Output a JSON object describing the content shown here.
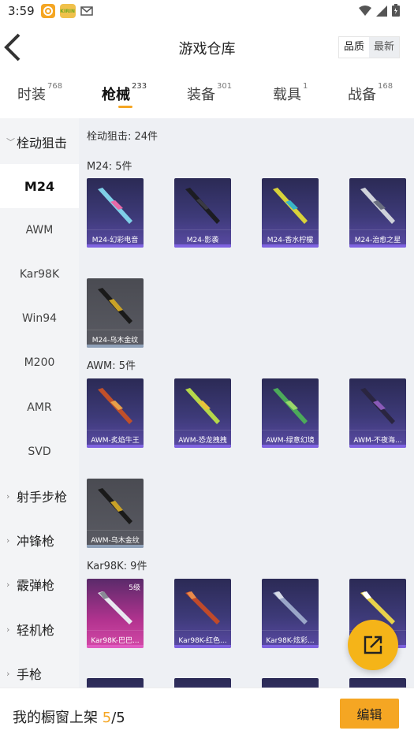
{
  "status": {
    "time": "3:59",
    "app2_label": "KIRIN"
  },
  "header": {
    "title": "游戏仓库",
    "sort_options": [
      "品质",
      "最新"
    ]
  },
  "tabs": [
    {
      "label": "时装",
      "count": "768"
    },
    {
      "label": "枪械",
      "count": "233"
    },
    {
      "label": "装备",
      "count": "301"
    },
    {
      "label": "载具",
      "count": "1"
    },
    {
      "label": "战备",
      "count": "168"
    }
  ],
  "sidebar": {
    "group_open": "栓动狙击",
    "subitems": [
      "M24",
      "AWM",
      "Kar98K",
      "Win94",
      "M200",
      "AMR",
      "SVD"
    ],
    "groups": [
      "射手步枪",
      "冲锋枪",
      "霰弹枪",
      "轻机枪",
      "手枪"
    ]
  },
  "content": {
    "category_header": "栓动狙击: 24件",
    "sections": [
      {
        "title": "M24: 5件",
        "items": [
          "M24-幻彩电音",
          "M24-影袭",
          "M24-香水柠檬",
          "M24-治愈之星",
          "M24-乌木金纹"
        ]
      },
      {
        "title": "AWM: 5件",
        "items": [
          "AWM-炙焰牛王",
          "AWM-恐龙拽拽",
          "AWM-绿意幻境",
          "AWM-不夜海...",
          "AWM-乌木金纹"
        ]
      },
      {
        "title": "Kar98K: 9件",
        "items": [
          "Kar98K-巴巴...",
          "Kar98K-红色...",
          "Kar98K-炫彩...",
          ""
        ],
        "first_level": "5级"
      }
    ]
  },
  "bottom": {
    "label": "我的橱窗上架 ",
    "count": "5",
    "total": "/5",
    "edit_label": "编辑"
  },
  "colors": {
    "accent": "#f5a623",
    "card_purple": "#3d3a78",
    "card_gray": "#5a5b63",
    "card_pink": "#b2338f"
  },
  "icons": [
    "wifi-icon",
    "signal-icon",
    "battery-icon",
    "mail-icon",
    "back-icon",
    "share-icon"
  ]
}
